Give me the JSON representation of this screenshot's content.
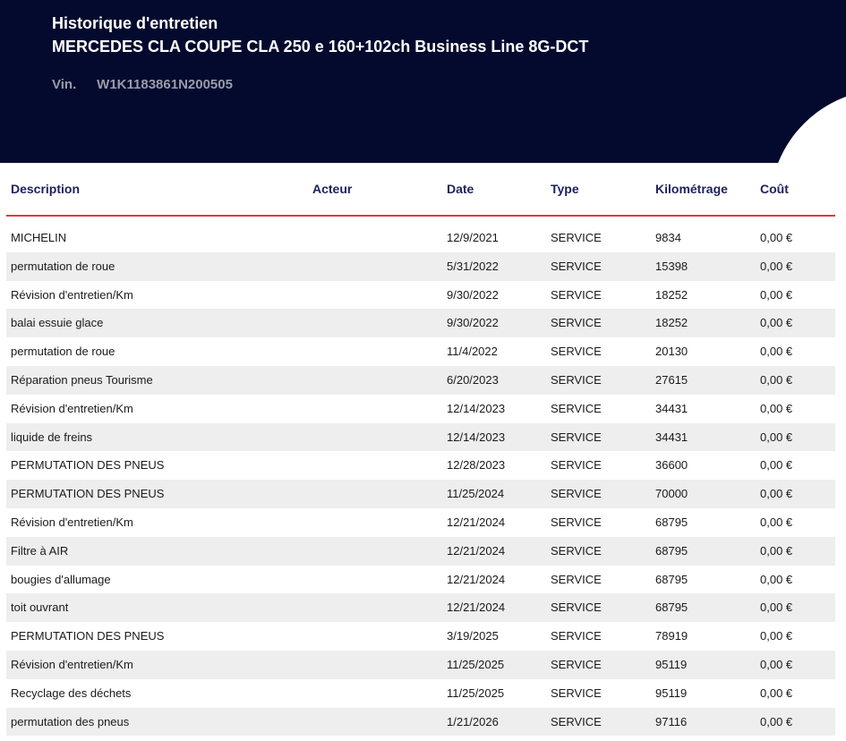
{
  "header": {
    "title_line1": "Historique d'entretien",
    "title_line2": "MERCEDES CLA COUPE CLA 250 e 160+102ch Business Line 8G-DCT",
    "vin_label": "Vin.",
    "vin_value": "W1K1183861N200505"
  },
  "colors": {
    "header_bg": "#040a2e",
    "header_text_color": "#1e2260",
    "divider": "#e03a3a",
    "row_alt": "#eeeeee"
  },
  "table": {
    "columns": {
      "description": "Description",
      "acteur": "Acteur",
      "date": "Date",
      "type": "Type",
      "kilometrage": "Kilométrage",
      "cout": "Coût"
    },
    "rows": [
      {
        "description": "MICHELIN",
        "acteur": "",
        "date": "12/9/2021",
        "type": "SERVICE",
        "km": "9834",
        "cout": "0,00 €"
      },
      {
        "description": "permutation de roue",
        "acteur": "",
        "date": "5/31/2022",
        "type": "SERVICE",
        "km": "15398",
        "cout": "0,00 €"
      },
      {
        "description": "Révision d'entretien/Km",
        "acteur": "",
        "date": "9/30/2022",
        "type": "SERVICE",
        "km": "18252",
        "cout": "0,00 €"
      },
      {
        "description": "balai essuie glace",
        "acteur": "",
        "date": "9/30/2022",
        "type": "SERVICE",
        "km": "18252",
        "cout": "0,00 €"
      },
      {
        "description": "permutation de roue",
        "acteur": "",
        "date": "11/4/2022",
        "type": "SERVICE",
        "km": "20130",
        "cout": "0,00 €"
      },
      {
        "description": "Réparation pneus Tourisme",
        "acteur": "",
        "date": "6/20/2023",
        "type": "SERVICE",
        "km": "27615",
        "cout": "0,00 €"
      },
      {
        "description": "Révision d'entretien/Km",
        "acteur": "",
        "date": "12/14/2023",
        "type": "SERVICE",
        "km": "34431",
        "cout": "0,00 €"
      },
      {
        "description": "liquide de freins",
        "acteur": "",
        "date": "12/14/2023",
        "type": "SERVICE",
        "km": "34431",
        "cout": "0,00 €"
      },
      {
        "description": "PERMUTATION DES PNEUS",
        "acteur": "",
        "date": "12/28/2023",
        "type": "SERVICE",
        "km": "36600",
        "cout": "0,00 €"
      },
      {
        "description": "PERMUTATION DES PNEUS",
        "acteur": "",
        "date": "11/25/2024",
        "type": "SERVICE",
        "km": "70000",
        "cout": "0,00 €"
      },
      {
        "description": "Révision d'entretien/Km",
        "acteur": "",
        "date": "12/21/2024",
        "type": "SERVICE",
        "km": "68795",
        "cout": "0,00 €"
      },
      {
        "description": "Filtre à  AIR",
        "acteur": "",
        "date": "12/21/2024",
        "type": "SERVICE",
        "km": "68795",
        "cout": "0,00 €"
      },
      {
        "description": "bougies d'allumage",
        "acteur": "",
        "date": "12/21/2024",
        "type": "SERVICE",
        "km": "68795",
        "cout": "0,00 €"
      },
      {
        "description": "toit ouvrant",
        "acteur": "",
        "date": "12/21/2024",
        "type": "SERVICE",
        "km": "68795",
        "cout": "0,00 €"
      },
      {
        "description": "PERMUTATION DES PNEUS",
        "acteur": "",
        "date": "3/19/2025",
        "type": "SERVICE",
        "km": "78919",
        "cout": "0,00 €"
      },
      {
        "description": "Révision d'entretien/Km",
        "acteur": "",
        "date": "11/25/2025",
        "type": "SERVICE",
        "km": "95119",
        "cout": "0,00 €"
      },
      {
        "description": "Recyclage des déchets",
        "acteur": "",
        "date": "11/25/2025",
        "type": "SERVICE",
        "km": "95119",
        "cout": "0,00 €"
      },
      {
        "description": "permutation des pneus",
        "acteur": "",
        "date": "1/21/2026",
        "type": "SERVICE",
        "km": "97116",
        "cout": "0,00 €"
      }
    ]
  }
}
